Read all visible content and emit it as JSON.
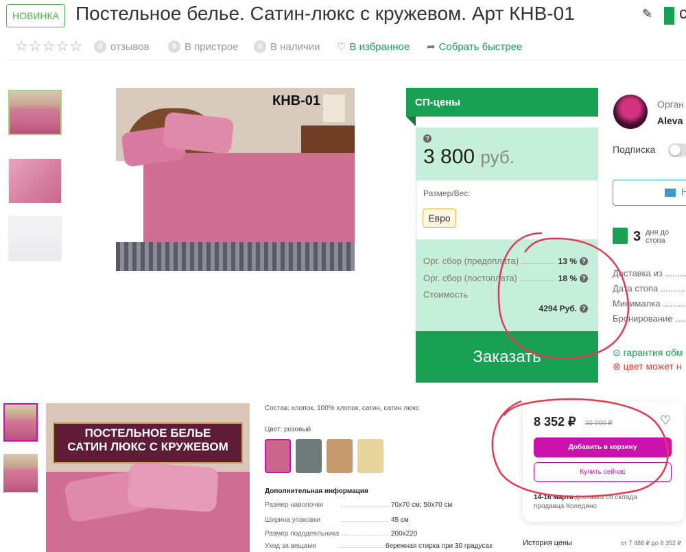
{
  "header": {
    "badge": "НОВИНКА",
    "title": "Постельное белье. Сатин-люкс с кружевом. Арт КНВ-01",
    "partial_right": "с",
    "reviews_count": "0",
    "reviews_label": "отзывов",
    "attach_count": "0",
    "attach_label": "В пристрое",
    "stock_count": "0",
    "stock_label": "В наличии",
    "favorite_label": "В избранное",
    "collect_label": "Собрать быстрее"
  },
  "main_photo": {
    "label": "КНВ-01"
  },
  "sp_card": {
    "header": "СП-цены",
    "price": "3 800",
    "currency": "руб.",
    "size_label": "Размер/Вес:",
    "size_option": "Евро",
    "fees": [
      {
        "label": "Орг. сбор (предоплата)",
        "value": "13 %"
      },
      {
        "label": "Орг. сбор (постоплата)",
        "value": "18 %"
      },
      {
        "label": "Стоимость",
        "value": "4294 Руб."
      }
    ],
    "order_button": "Заказать"
  },
  "organizer": {
    "label": "Орган",
    "name": "Aleva",
    "subscribe_label": "Подписка",
    "message_btn": "Н",
    "days_num": "3",
    "days_text_1": "дня до",
    "days_text_2": "стопа",
    "rows": [
      "Доставка из ...........",
      "Дата стопа ...........",
      "Минималка ...........",
      "Бронирование ..........."
    ],
    "guarantee": "гарантия обм",
    "color_warning": "цвет может н"
  },
  "banner": {
    "line1": "ПОСТЕЛЬНОЕ БЕЛЬЕ",
    "line2": "САТИН ЛЮКС С КРУЖЕВОМ"
  },
  "details": {
    "composition": "Состав: хлопок, 100% хлопок, сатин, сатин люкс",
    "color": "Цвет: розовый",
    "swatch_colors": [
      "#c9668a",
      "#6d7a78",
      "#c79a6e",
      "#e7d39c"
    ],
    "extra_head": "Дополнительная информация",
    "rows": [
      {
        "k": "Размер наволочки",
        "v": "70x70 см; 50x70 см"
      },
      {
        "k": "Ширина упаковки",
        "v": "45 см"
      },
      {
        "k": "Размер пододеяльника",
        "v": "200x220"
      },
      {
        "k": "Уход за вещами",
        "v": "бережная стирка при 30 градусах"
      }
    ]
  },
  "wb_card": {
    "price": "8 352 ₽",
    "old_price": "32 000 ₽",
    "cart_btn": "Добавить в корзину",
    "buy_btn": "Купить сейчас",
    "delivery_date": "14-16 марта",
    "delivery_text": " доставка со склада продавца Коледино",
    "history_label": "История цены",
    "history_range": "от 7 488 ₽ до 8 352 ₽"
  },
  "colors": {
    "accent_green": "#1aa053",
    "wb_purple": "#cb11ab",
    "annotation_red": "#e53950"
  }
}
